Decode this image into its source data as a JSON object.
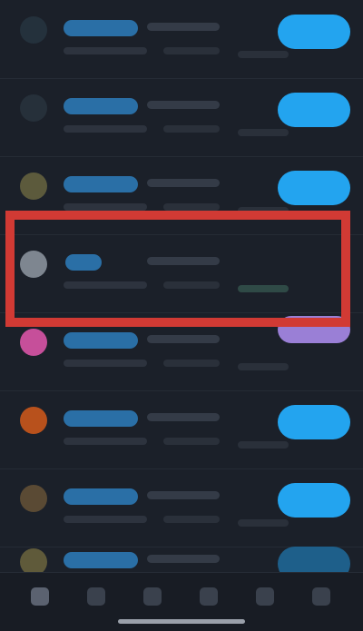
{
  "feed": {
    "rows": [
      {
        "avatar_color": "#24313c",
        "name_color": "#2a6fa6",
        "button_state": "follow"
      },
      {
        "avatar_color": "#26303a",
        "name_color": "#2a6fa6",
        "button_state": "follow"
      },
      {
        "avatar_color": "#5c5a3c",
        "name_color": "#2a6fa6",
        "button_state": "follow"
      },
      {
        "avatar_color": "#7e8690",
        "name_color": "#2a6fa6",
        "button_state": "none"
      },
      {
        "avatar_color": "#c64f9a",
        "name_color": "#2a6fa6",
        "button_state": "purple"
      },
      {
        "avatar_color": "#b8511c",
        "name_color": "#2a6fa6",
        "button_state": "follow"
      },
      {
        "avatar_color": "#5a4a34",
        "name_color": "#2a6fa6",
        "button_state": "follow"
      },
      {
        "avatar_color": "#5f5a3a",
        "name_color": "#2a6fa6",
        "button_state": "dim"
      }
    ],
    "highlight_color": "#d13a34"
  },
  "tabbar": {
    "tabs": [
      {
        "icon": "home-icon",
        "active": true
      },
      {
        "icon": "search-icon",
        "active": false
      },
      {
        "icon": "create-icon",
        "active": false
      },
      {
        "icon": "notifications-icon",
        "active": false
      },
      {
        "icon": "messages-icon",
        "active": false
      },
      {
        "icon": "profile-icon",
        "active": false
      }
    ]
  }
}
